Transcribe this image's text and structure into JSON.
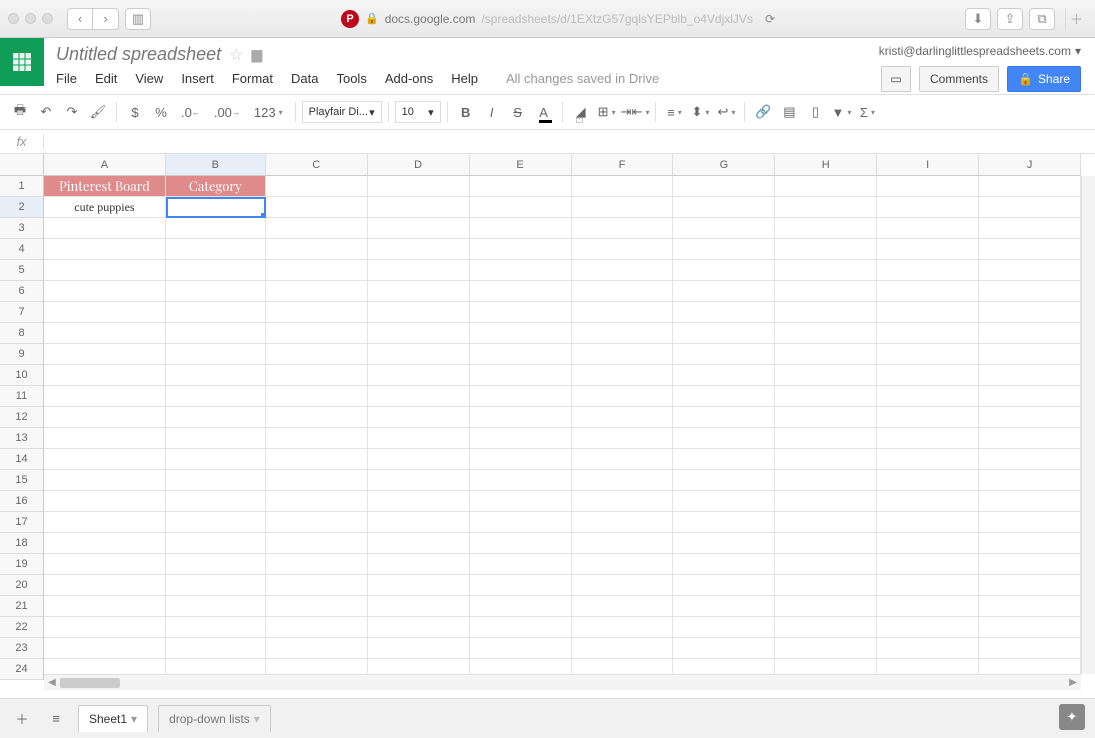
{
  "browser": {
    "url_host": "docs.google.com",
    "url_path": "/spreadsheets/d/1EXtzG57gqlsYEPblb_o4VdjxlJVs"
  },
  "account": "kristi@darlinglittlespreadsheets.com",
  "doc_title": "Untitled spreadsheet",
  "menus": [
    "File",
    "Edit",
    "View",
    "Insert",
    "Format",
    "Data",
    "Tools",
    "Add-ons",
    "Help"
  ],
  "save_status": "All changes saved in Drive",
  "buttons": {
    "comments": "Comments",
    "share": "Share"
  },
  "toolbar": {
    "currency": "$",
    "percent": "%",
    "dec_dec": ".0",
    "inc_dec": ".00",
    "more_fmt": "123",
    "font": "Playfair Di...",
    "size": "10",
    "bold": "B",
    "italic": "I",
    "strike": "S",
    "textcolor": "A"
  },
  "fx_label": "fx",
  "columns": [
    "A",
    "B",
    "C",
    "D",
    "E",
    "F",
    "G",
    "H",
    "I",
    "J"
  ],
  "rows": 24,
  "active_row": 2,
  "active_col": "B",
  "headers": {
    "A1": "Pinterest Board",
    "B1": "Category"
  },
  "data": {
    "A2": "cute puppies"
  },
  "sheets": [
    "Sheet1",
    "drop-down lists"
  ]
}
